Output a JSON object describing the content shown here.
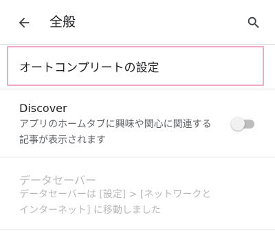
{
  "header": {
    "title": "全般",
    "back_icon": "arrow-back-icon",
    "search_icon": "search-icon"
  },
  "settings": {
    "autocomplete": {
      "label": "オートコンプリートの設定"
    },
    "discover": {
      "title": "Discover",
      "description": "アプリのホームタブに興味や関心に関連する記事が表示されます",
      "toggle_on": false
    },
    "data_saver": {
      "title": "データセーバー",
      "description": "データセーバーは [設定] > [ネットワークとインターネット] に移動しました",
      "enabled": false
    }
  },
  "colors": {
    "highlight_border": "#f4a6c6",
    "text_primary": "#202124",
    "text_secondary": "#5f6368",
    "text_disabled": "#b8b8b8",
    "divider": "#e0e0e0"
  }
}
